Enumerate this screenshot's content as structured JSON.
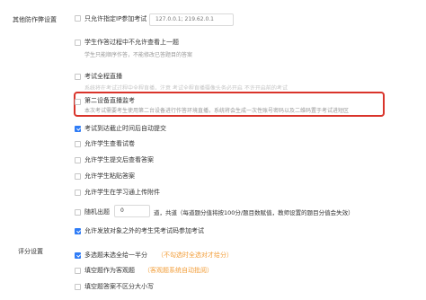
{
  "anti_cheat": {
    "section_label": "其他防作弊设置",
    "ip_only": {
      "label": "只允许指定IP参加考试",
      "ip_value": "127.0.0.1; 219.62.0.1",
      "checked": false
    },
    "no_review": {
      "label": "学生作答过程中不允许查看上一题",
      "desc": "学生只能顺序作答，不能修改已答题目的答案",
      "checked": false
    },
    "full_recording": {
      "label": "考试全程直播",
      "desc": "系统将在考试过程中全程直播，注意 考试全程直播摄像头务必开启 不许开启前的考试",
      "checked": false
    },
    "second_device": {
      "label": "第二设备直播监考",
      "desc": "本次考试需要考生使用第二台设备进行作答环境直播，系统将会生成一次性账号密码以及二维码置于考试进短区",
      "checked": false
    },
    "auto_submit": {
      "label": "考试到达截止时间后自动提交",
      "checked": true
    },
    "allow_view_paper": {
      "label": "允许学生查看试卷",
      "checked": false
    },
    "allow_view_answer": {
      "label": "允许学生提交后查看答案",
      "checked": false
    },
    "allow_paste": {
      "label": "允许学生粘贴答案",
      "checked": false
    },
    "allow_upload": {
      "label": "允许学生在学习通上传附件",
      "checked": false
    },
    "random_pick": {
      "label": "随机出题",
      "count_value": "0",
      "suffix": "道，共道（每道题分值将按100分/题目数赋值，教师设置的题目分值会失效）",
      "checked": false
    },
    "other_candidates": {
      "label": "允许发放对象之外的考生凭考试码参加考试",
      "checked": true
    }
  },
  "scoring": {
    "section_label": "评分设置",
    "multi_half": {
      "label": "多选题未选全给一半分",
      "note": "（不勾选时全选对才给分）",
      "checked": true
    },
    "fill_as_subjective": {
      "label": "填空题作为客观题",
      "note": "（客观题系统自动批阅）",
      "checked": false
    },
    "fill_case": {
      "label": "填空题答案不区分大小写",
      "checked": false
    }
  },
  "colors": {
    "accent": "#2f7cf6",
    "highlight_border": "#d9342b",
    "note_orange": "#f29d38"
  }
}
